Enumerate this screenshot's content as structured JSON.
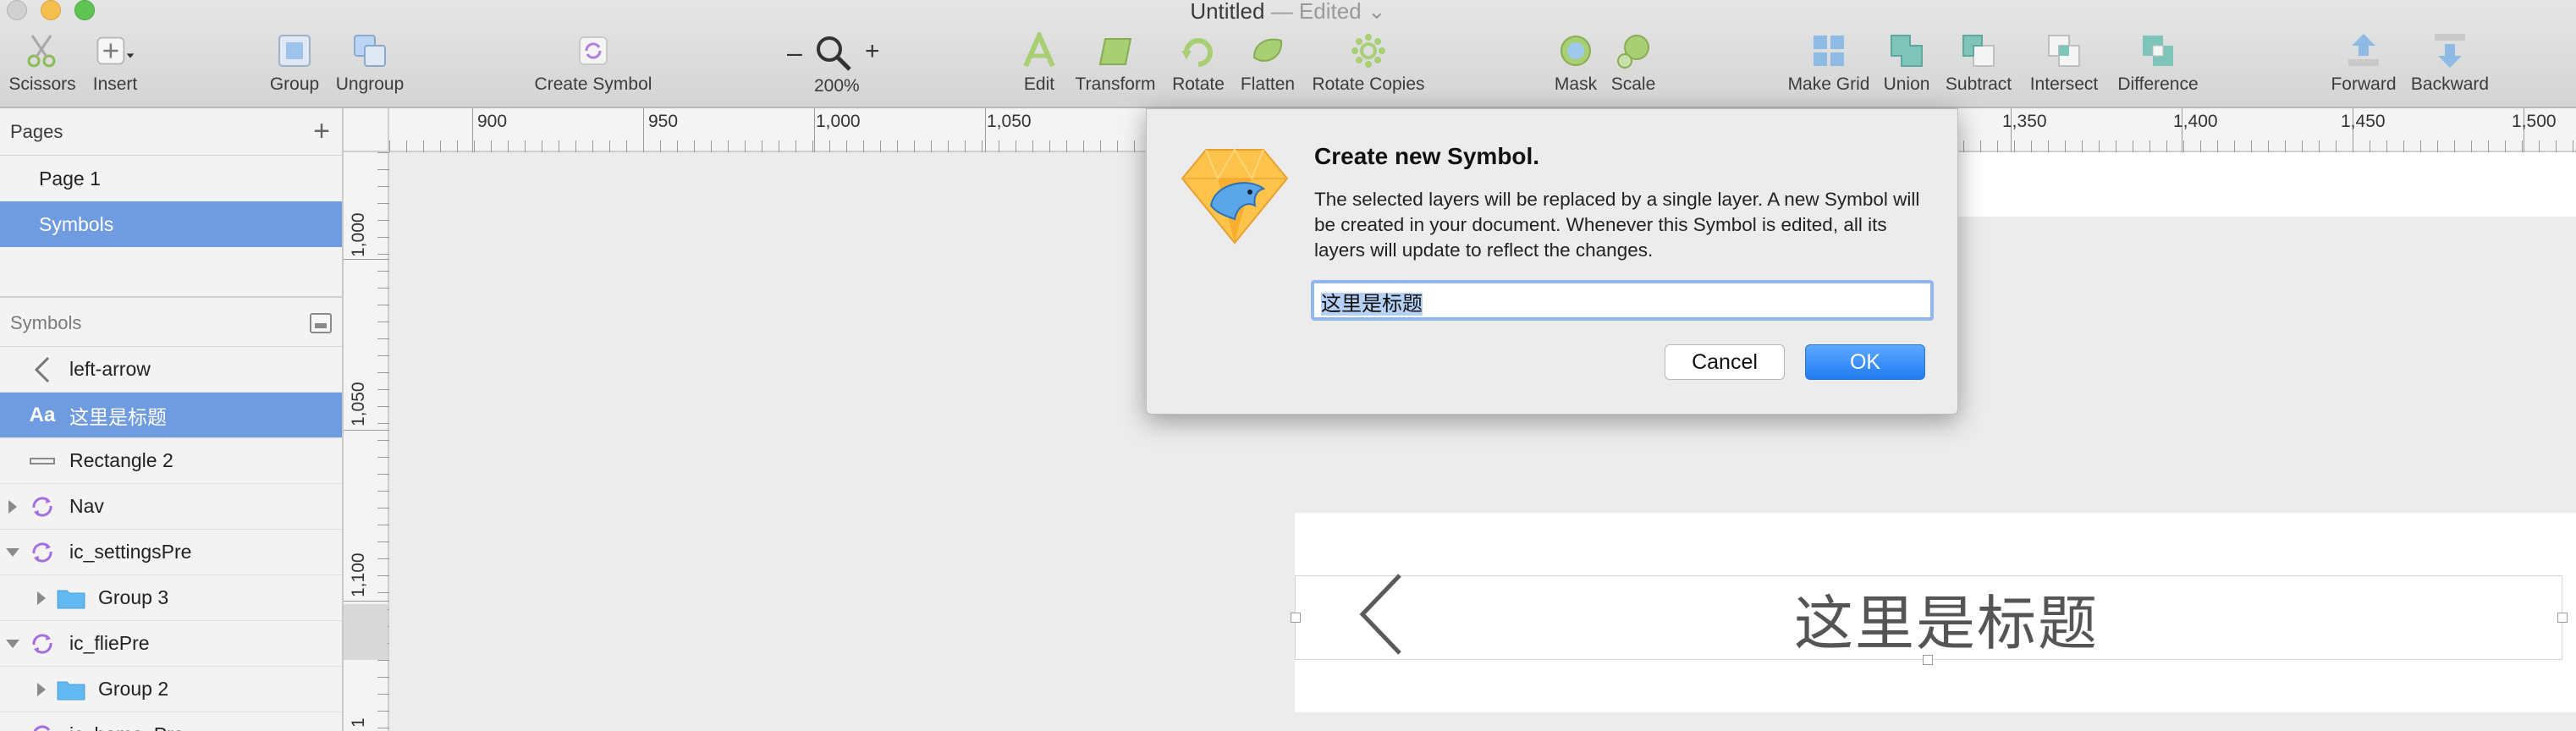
{
  "window": {
    "title": "Untitled",
    "edited": "— Edited ⌄"
  },
  "toolbar": {
    "scissors": "Scissors",
    "insert": "Insert",
    "group": "Group",
    "ungroup": "Ungroup",
    "create_symbol": "Create Symbol",
    "zoom_minus": "–",
    "zoom_plus": "+",
    "zoom_level": "200%",
    "edit": "Edit",
    "transform": "Transform",
    "rotate": "Rotate",
    "flatten": "Flatten",
    "rotate_copies": "Rotate Copies",
    "mask": "Mask",
    "scale": "Scale",
    "make_grid": "Make Grid",
    "union": "Union",
    "subtract": "Subtract",
    "intersect": "Intersect",
    "difference": "Difference",
    "forward": "Forward",
    "backward": "Backward"
  },
  "sidebar": {
    "pages_header": "Pages",
    "add_page": "+",
    "pages": [
      "Page 1",
      "Symbols"
    ],
    "symbols_header": "Symbols",
    "layers": [
      {
        "name": "left-arrow"
      },
      {
        "name": "这里是标题"
      },
      {
        "name": "Rectangle 2"
      },
      {
        "name": "Nav"
      },
      {
        "name": "ic_settingsPre"
      },
      {
        "name": "Group 3"
      },
      {
        "name": "ic_fliePre"
      },
      {
        "name": "Group 2"
      },
      {
        "name": "ic_home_Pre"
      }
    ]
  },
  "ruler": {
    "top": [
      "900",
      "950",
      "1,000",
      "1,050",
      "1,350",
      "1,400",
      "1,450",
      "1,500"
    ],
    "left": [
      "1,000",
      "1,050",
      "1,100",
      "1"
    ]
  },
  "canvas": {
    "nav_title": "这里是标题"
  },
  "dialog": {
    "title": "Create new Symbol.",
    "body": "The selected layers will be replaced by a single layer. A new Symbol will be created in your document. Whenever this Symbol is edited, all its layers will update to reflect the changes.",
    "input_value": "这里是标题",
    "cancel": "Cancel",
    "ok": "OK"
  },
  "colors": {
    "selection": "#6f9be0",
    "ok_button": "#1f7cf2",
    "symbol_icon": "#a46ee0",
    "folder_icon": "#62b8f0"
  }
}
